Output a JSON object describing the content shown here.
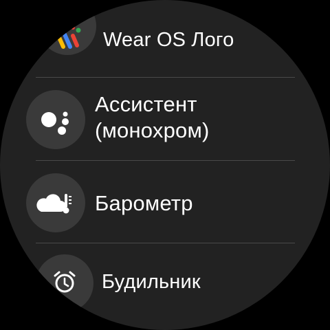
{
  "watch_face_list": {
    "items": [
      {
        "label": "Wear OS Лого",
        "icon": "wear-os-logo-icon"
      },
      {
        "label": "Ассистент\n(монохром)",
        "icon": "assistant-dots-icon"
      },
      {
        "label": "Барометр",
        "icon": "cloud-thermometer-icon"
      },
      {
        "label": "Будильник",
        "icon": "alarm-clock-icon"
      }
    ]
  },
  "colors": {
    "background": "#222222",
    "icon_circle": "#3a3a3a",
    "divider": "#4a4a4a",
    "text": "#ffffff",
    "google_blue": "#4285F4",
    "google_red": "#EA4335",
    "google_yellow": "#FBBC05",
    "google_green": "#34A853"
  }
}
